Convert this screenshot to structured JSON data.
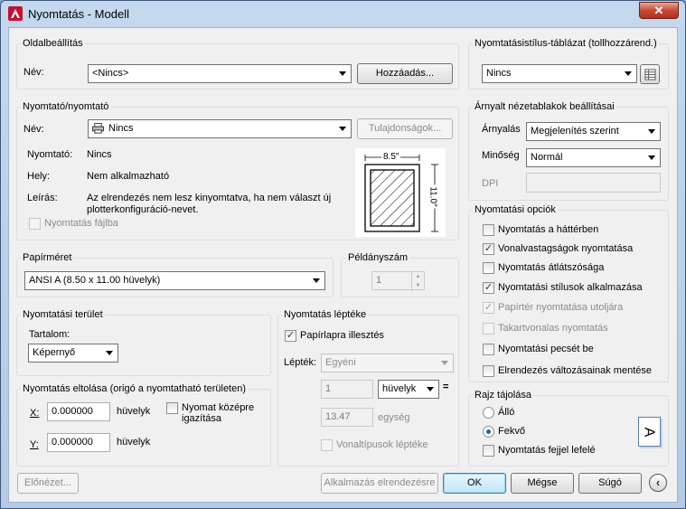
{
  "window": {
    "title": "Nyomtatás - Modell",
    "close_label": "✕"
  },
  "page_setup": {
    "title": "Oldalbeállítás",
    "name_label": "Név:",
    "name_value": "<Nincs>",
    "add_button": "Hozzáadás..."
  },
  "printer": {
    "title": "Nyomtató/nyomtató",
    "name_label": "Név:",
    "name_value": "Nincs",
    "properties_button": "Tulajdonságok...",
    "printer_label": "Nyomtató:",
    "printer_value": "Nincs",
    "location_label": "Hely:",
    "location_value": "Nem alkalmazható",
    "desc_label": "Leírás:",
    "desc_line1": "Az elrendezés nem lesz kinyomtatva, ha nem választ új",
    "desc_line2": "plotterkonfiguráció-nevet.",
    "print_to_file": "Nyomtatás fájlba",
    "paper_width": "8.5″",
    "paper_height": "11.0″"
  },
  "paper_size": {
    "title": "Papírméret",
    "value": "ANSI A (8.50 x 11.00 hüvelyk)"
  },
  "copies": {
    "title": "Példányszám",
    "value": "1"
  },
  "plot_area": {
    "title": "Nyomtatási terület",
    "what_label": "Tartalom:",
    "value": "Képernyő"
  },
  "plot_offset": {
    "title": "Nyomtatás eltolása (origó a nyomtatható területen)",
    "x_label": "X:",
    "x_value": "0.000000",
    "x_unit": "hüvelyk",
    "y_label": "Y:",
    "y_value": "0.000000",
    "y_unit": "hüvelyk",
    "center_line1": "Nyomat középre",
    "center_line2": "igazítása"
  },
  "plot_scale": {
    "title": "Nyomtatás léptéke",
    "fit_paper": "Papírlapra illesztés",
    "scale_label": "Lépték:",
    "scale_value": "Egyéni",
    "value1": "1",
    "unit_value": "hüvelyk",
    "equals": "=",
    "value2": "13.47",
    "unit2": "egység",
    "scale_lineweights": "Vonaltípusok léptéke"
  },
  "plot_style_table": {
    "title": "Nyomtatásistílus-táblázat (tollhozzárend.)",
    "value": "Nincs"
  },
  "shaded_viewport": {
    "title": "Árnyalt nézetablakok beállításai",
    "shade_label": "Árnyalás",
    "shade_value": "Megjelenítés szerint",
    "quality_label": "Minőség",
    "quality_value": "Normál",
    "dpi_label": "DPI"
  },
  "plot_options": {
    "title": "Nyomtatási opciók",
    "items": [
      {
        "label": "Nyomtatás a háttérben",
        "checked": ""
      },
      {
        "label": "Vonalvastagságok nyomtatása",
        "checked": "✓"
      },
      {
        "label": "Nyomtatás átlátszósága",
        "checked": ""
      },
      {
        "label": "Nyomtatási stílusok alkalmazása",
        "checked": "✓"
      },
      {
        "label": "Papírtér nyomtatása utoljára",
        "checked": "✓"
      },
      {
        "label": "Takartvonalas nyomtatás",
        "checked": ""
      },
      {
        "label": "Nyomtatási pecsét be",
        "checked": ""
      },
      {
        "label": "Elrendezés változásainak mentése",
        "checked": ""
      }
    ]
  },
  "orientation": {
    "title": "Rajz tájolása",
    "portrait": "Álló",
    "landscape": "Fekvő",
    "upside_down": "Nyomtatás fejjel lefelé",
    "icon_letter": "A"
  },
  "footer": {
    "preview": "Előnézet...",
    "apply": "Alkalmazás elrendezésre",
    "ok": "OK",
    "cancel": "Mégse",
    "help": "Súgó"
  },
  "colors": {
    "accent": "#3c7fb1",
    "title_bar": "#c4d8ee",
    "close": "#c74a35"
  }
}
